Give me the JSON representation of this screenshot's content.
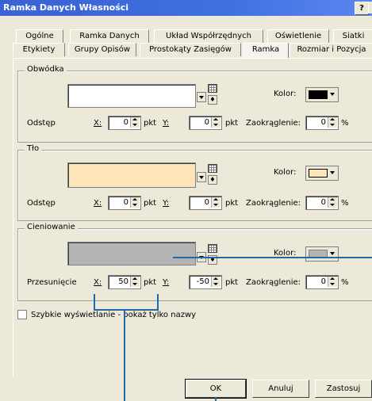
{
  "window": {
    "title": "Ramka Danych Własności",
    "help": "?"
  },
  "tabs_row1": [
    "Ogólne",
    "Ramka Danych",
    "Układ Współrzędnych",
    "Oświetlenie",
    "Siatki"
  ],
  "tabs_row2": [
    "Etykiety",
    "Grupy Opisów",
    "Prostokąty Zasięgów",
    "Ramka",
    "Rozmiar i Pozycja"
  ],
  "active_tab": "Ramka",
  "obwodka": {
    "legend": "Obwódka",
    "kolor_label": "Kolor:",
    "kolor_value": "#000000",
    "odstep_label": "Odstęp",
    "x_label": "X:",
    "x_value": "0",
    "unit1": "pkt",
    "y_label": "Y:",
    "y_value": "0",
    "unit2": "pkt",
    "zaokr_label": "Zaokrąglenie:",
    "zaokr_value": "0",
    "percent": "%"
  },
  "tlo": {
    "legend": "Tło",
    "preview_color": "#ffe6b8",
    "kolor_label": "Kolor:",
    "kolor_value": "#ffe6b8",
    "odstep_label": "Odstęp",
    "x_label": "X:",
    "x_value": "0",
    "unit1": "pkt",
    "y_label": "Y:",
    "y_value": "0",
    "unit2": "pkt",
    "zaokr_label": "Zaokrąglenie:",
    "zaokr_value": "0",
    "percent": "%"
  },
  "cieniowanie": {
    "legend": "Cieniowanie",
    "preview_color": "#b4b4b4",
    "kolor_label": "Kolor:",
    "kolor_value": "#b4b4b4",
    "przes_label": "Przesunięcie",
    "x_label": "X:",
    "x_value": "50",
    "unit1": "pkt",
    "y_label": "Y:",
    "y_value": "-50",
    "unit2": "pkt",
    "zaokr_label": "Zaokrąglenie:",
    "zaokr_value": "0",
    "percent": "%"
  },
  "checkbox": {
    "label": "Szybkie wyświetlanie - pokaż tylko nazwy",
    "checked": false
  },
  "buttons": {
    "ok": "OK",
    "cancel": "Anuluj",
    "apply": "Zastosuj"
  },
  "colors": {
    "callout": "#1e6aa8",
    "titlebar": "#3a62d4"
  }
}
